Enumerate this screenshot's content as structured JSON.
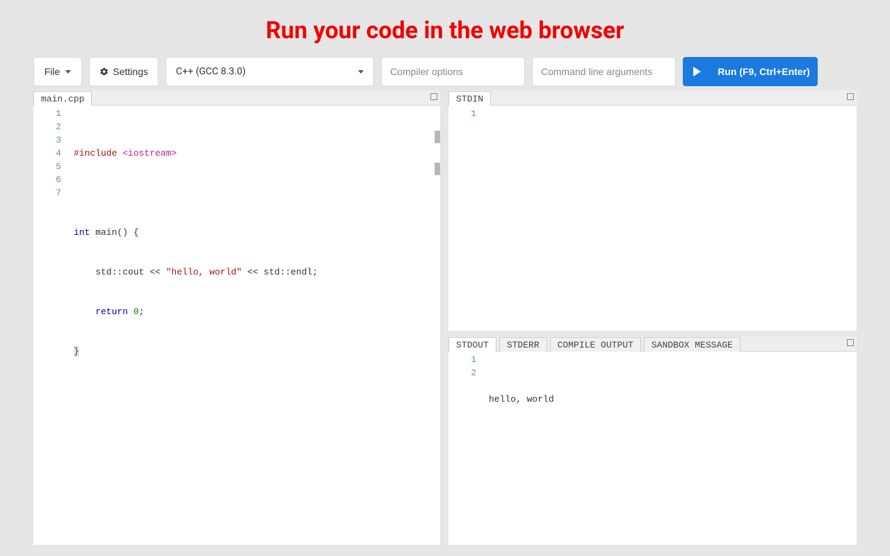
{
  "banner": "Run your code in the web browser",
  "toolbar": {
    "file_label": "File",
    "settings_label": "Settings",
    "language_selected": "C++ (GCC 8.3.0)",
    "compiler_options_placeholder": "Compiler options",
    "cmd_args_placeholder": "Command line arguments",
    "run_label": "Run (F9, Ctrl+Enter)"
  },
  "editor": {
    "tab_label": "main.cpp",
    "line_numbers": [
      "1",
      "2",
      "3",
      "4",
      "5",
      "6",
      "7"
    ],
    "code": {
      "l1_include": "#include ",
      "l1_lib": "<iostream>",
      "l3_kw_int": "int",
      "l3_rest": " main() {",
      "l4_pre": "    std::cout << ",
      "l4_str": "\"hello, world\"",
      "l4_post": " << std::endl;",
      "l5_kw_ret": "    return ",
      "l5_num": "0",
      "l5_semi": ";",
      "l6_brace": "}"
    }
  },
  "stdin": {
    "tab_label": "STDIN",
    "line_numbers": [
      "1"
    ]
  },
  "output": {
    "tabs": {
      "stdout": "STDOUT",
      "stderr": "STDERR",
      "compile": "COMPILE OUTPUT",
      "sandbox": "SANDBOX MESSAGE"
    },
    "line_numbers": [
      "1",
      "2"
    ],
    "lines": {
      "l1": "hello, world",
      "l2": ""
    }
  }
}
